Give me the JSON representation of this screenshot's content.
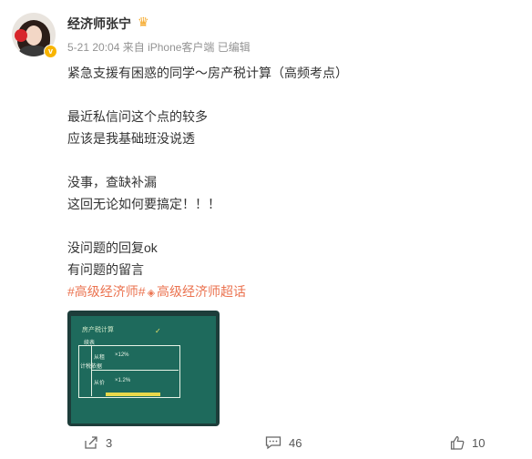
{
  "user": {
    "name": "经济师张宁",
    "badge_icon": "crown-icon",
    "verified_icon": "verified-v-icon"
  },
  "meta": {
    "time": "5-21 20:04",
    "source": "来自 iPhone客户端",
    "edited": "已编辑"
  },
  "content": {
    "lines": [
      "紧急支援有困惑的同学～房产税计算（高频考点）",
      "",
      "最近私信问这个点的较多",
      "应该是我基础班没说透",
      "",
      "没事，查缺补漏",
      "这回无论如何要搞定！！！",
      "",
      "没问题的回复ok",
      "有问题的留言"
    ],
    "tags": {
      "tag1": "#高级经济师#",
      "supertopic": "高级经济师超话"
    }
  },
  "image": {
    "title": "房产税计算",
    "rows": [
      "从租",
      "从价"
    ],
    "left_label": "计税依据",
    "formula_1": "×12%",
    "formula_2": "×1.2%"
  },
  "actions": {
    "repost": "3",
    "comment": "46",
    "like": "10"
  },
  "colors": {
    "accent": "#eb7350",
    "meta": "#939393",
    "text": "#333333"
  }
}
